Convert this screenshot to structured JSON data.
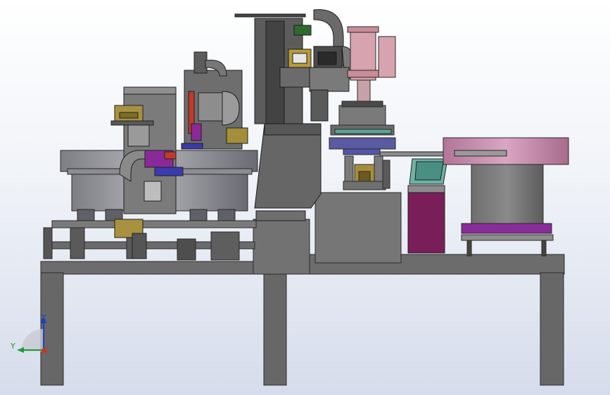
{
  "scene": {
    "subject": "cad-assembly-side-view",
    "colors": {
      "frame": "#6f6f6f",
      "frame_dark": "#4f4f4f",
      "bowl": "#9a9aa0",
      "bowl_dark": "#6d6d74",
      "purple": "#8a2b9a",
      "magenta": "#7a1e5a",
      "pink_bowl": "#c98ab0",
      "light_pink": "#d7a3ae",
      "gold": "#a58e39",
      "blue": "#3a3aa8",
      "teal": "#6bb3a5",
      "red": "#c0392b"
    }
  },
  "triad": {
    "z_label": "Z",
    "y_label": "Y",
    "z_color": "#1f3fbf",
    "y_color": "#1f9a3a",
    "x_color": "#c0392b"
  }
}
